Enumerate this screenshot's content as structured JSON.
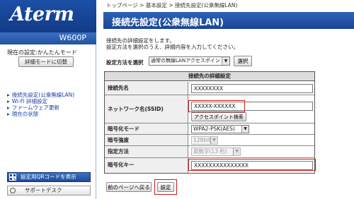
{
  "brand": {
    "logo": "Aterm",
    "model": "W600P"
  },
  "sidebar": {
    "mode_text": "現在の設定:かんたんモード",
    "mode_button": "詳細モードに切替",
    "links": [
      "接続先設定(公衆無線LAN)",
      "Wi-Fi 詳細設定",
      "ファームウェア更新",
      "現在の状態"
    ],
    "qr_button": "設定用QRコードを表示",
    "support_button": "サポートデスク"
  },
  "breadcrumb": "トップページ > 基本設定 > 接続先設定(公衆無線LAN)",
  "page_title": "接続先設定(公衆無線LAN)",
  "description": [
    "接続先の詳細設定をします。",
    "設定方法を選択のうえ、詳細内容を入力してください。"
  ],
  "method": {
    "label": "設定方法を選択",
    "selected": "通常の無線LANアクセスポイント",
    "button": "選択"
  },
  "table": {
    "header": "接続先の詳細設定",
    "rows": {
      "name": {
        "label": "接続先名",
        "value": "XXXXXXXX"
      },
      "ssid": {
        "label": "ネットワーク名(SSID)",
        "value": "XXXXX-XXXXXX",
        "button": "アクセスポイント検索"
      },
      "encryption_mode": {
        "label": "暗号化モード",
        "value": "WPA2-PSK(AES)"
      },
      "strength": {
        "label": "暗号強度",
        "value": "128bit"
      },
      "method": {
        "label": "指定方法",
        "value": "英数字(13 桁)"
      },
      "key": {
        "label": "暗号化キー",
        "value": "XXXXXXXXXXXXXXX"
      }
    }
  },
  "buttons": {
    "prev": "前のページへ戻る",
    "set": "設定"
  },
  "colors": {
    "brand_blue": "#1a4594",
    "highlight_red": "#d11a1a"
  }
}
